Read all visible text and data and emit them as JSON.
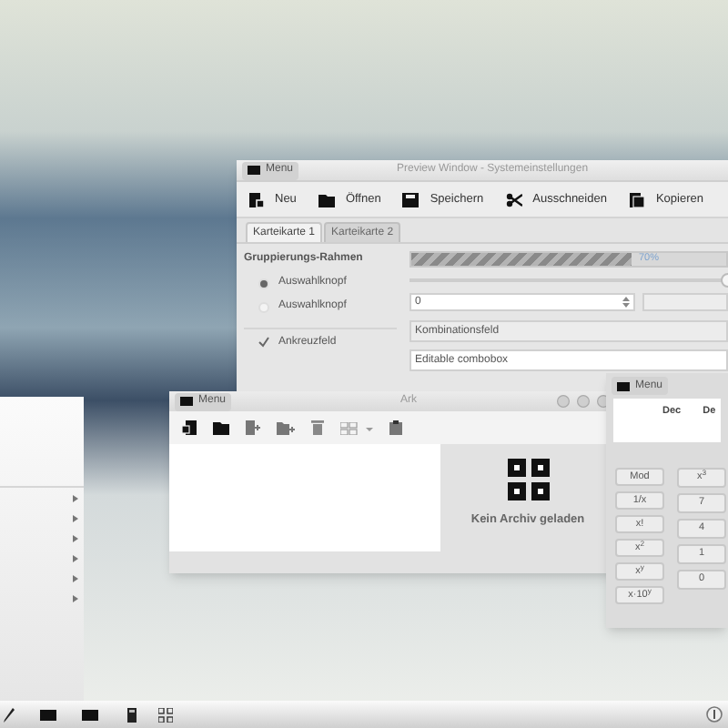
{
  "main_window": {
    "menu_button": "Menu",
    "title": "Preview Window - Systemeinstellungen",
    "toolbar": [
      {
        "label": "Neu",
        "kind": "new"
      },
      {
        "label": "Öffnen",
        "kind": "open"
      },
      {
        "label": "Speichern",
        "kind": "save"
      },
      {
        "label": "Ausschneiden",
        "kind": "cut"
      },
      {
        "label": "Kopieren",
        "kind": "copy"
      }
    ],
    "tabs": [
      {
        "label": "Karteikarte 1",
        "selected": true
      },
      {
        "label": "Karteikarte 2",
        "selected": false
      }
    ],
    "group_title": "Gruppierungs-Rahmen",
    "radios": [
      {
        "label": "Auswahlknopf",
        "selected": true
      },
      {
        "label": "Auswahlknopf",
        "selected": false
      }
    ],
    "checkbox": {
      "label": "Ankreuzfeld",
      "checked": true
    },
    "progress": {
      "level": 0.7,
      "text": "70%"
    },
    "slider": {
      "level": 1
    },
    "spinbox": {
      "value": "0"
    },
    "combobox": {
      "value": "Kombinationsfeld"
    },
    "editable_combobox": {
      "value": "Editable combobox"
    }
  },
  "ark_window": {
    "menu_button": "Menu",
    "title": "Ark",
    "empty_message": "Kein Archiv geladen"
  },
  "calculator": {
    "menu_button": "Menu",
    "display": [
      "Dec",
      "De"
    ],
    "columns": [
      [
        "Mod",
        "1/x",
        "x!",
        "x$^{2}$",
        "x$^{y}$",
        "x·10$^{y}$"
      ],
      [
        "x$^{3}$",
        "7",
        "4",
        "1",
        "0"
      ]
    ]
  }
}
